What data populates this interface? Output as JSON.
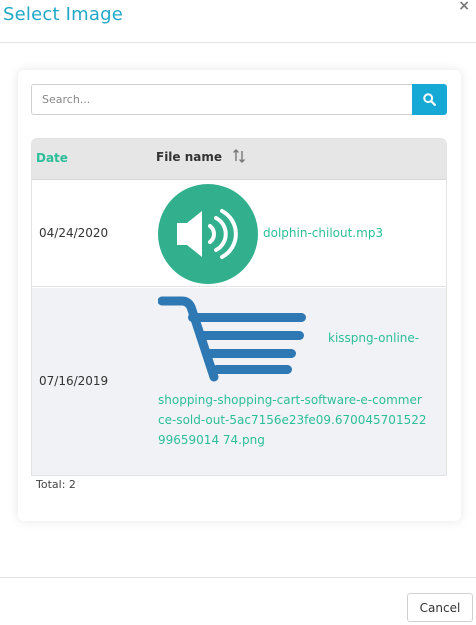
{
  "dialog": {
    "title": "Select Image",
    "close_label": "×"
  },
  "search": {
    "placeholder": "Search...",
    "value": "",
    "button_icon": "search-icon"
  },
  "table": {
    "columns": [
      {
        "label": "Date",
        "active": true
      },
      {
        "label": "File name",
        "sortable": true
      }
    ],
    "rows": [
      {
        "date": "04/24/2020",
        "file_name": "dolphin-chilout.mp3",
        "thumbnail_icon": "audio-speaker-icon"
      },
      {
        "date": "07/16/2019",
        "file_name_line1": "kisspng-online-",
        "file_name_rest": "shopping-shopping-cart-software-e-commerce-sold-out-5ac7156e23fe09.67004570152299659014 74.png",
        "thumbnail_icon": "shopping-cart-icon"
      }
    ],
    "total_label": "Total: 2"
  },
  "footer": {
    "cancel_label": "Cancel"
  },
  "colors": {
    "accent": "#20a8c8",
    "link": "#2bbf99",
    "search_button": "#16a9d6",
    "audio_circle": "#32b08e",
    "cart_blue": "#2e78b4"
  }
}
